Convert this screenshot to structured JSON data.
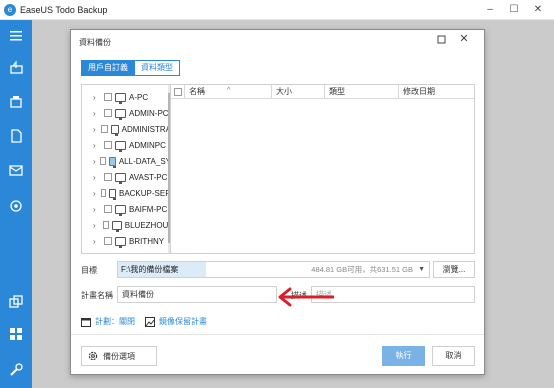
{
  "app": {
    "title": "EaseUS Todo Backup",
    "controls": {
      "minimize": "–",
      "maximize": "☐",
      "close": "✕"
    }
  },
  "sidebar": {
    "items": [
      {
        "icon": "menu-icon"
      },
      {
        "icon": "disk-backup-icon"
      },
      {
        "icon": "system-backup-icon"
      },
      {
        "icon": "file-backup-icon"
      },
      {
        "icon": "mail-backup-icon"
      },
      {
        "icon": "smart-backup-icon"
      },
      {
        "icon": "clone-icon"
      },
      {
        "icon": "tools-icon"
      },
      {
        "icon": "settings-wrench-icon"
      }
    ],
    "accent_color": "#2b88d8"
  },
  "dialog": {
    "title": "資料備份",
    "tabs": [
      {
        "label": "用戶自訂義",
        "active": true
      },
      {
        "label": "資料類型",
        "active": false
      }
    ],
    "tree": [
      {
        "label": "A-PC",
        "highlight": false
      },
      {
        "label": "ADMIN-PC",
        "highlight": false
      },
      {
        "label": "ADMINISTRA",
        "highlight": false
      },
      {
        "label": "ADMINPC",
        "highlight": false
      },
      {
        "label": "ALL-DATA_SY",
        "highlight": true
      },
      {
        "label": "AVAST-PC",
        "highlight": false
      },
      {
        "label": "BACKUP-SER",
        "highlight": false
      },
      {
        "label": "BAIFM-PC",
        "highlight": false
      },
      {
        "label": "BLUEZHOU-",
        "highlight": false
      },
      {
        "label": "BRITHNY",
        "highlight": false
      }
    ],
    "columns": {
      "name": "名稱",
      "size": "大小",
      "type": "類型",
      "modified": "修改日期"
    },
    "target": {
      "label": "目標",
      "path": "F:\\我的備份檔案",
      "space": "484.81 GB可用，共631.51 GB",
      "browse": "瀏覽..."
    },
    "plan_name": {
      "label": "計畫名稱",
      "value": "資料備份"
    },
    "description": {
      "label": "描述",
      "placeholder": "描述"
    },
    "schedule_link": "計劃：關閉",
    "image_retain_link": "鏡像保留計畫",
    "backup_options": "備份選項",
    "execute": "執行",
    "cancel": "取消"
  },
  "colors": {
    "accent": "#2b88d8",
    "execute_button": "#7ab2e6",
    "annotation_arrow": "#d9202a"
  }
}
